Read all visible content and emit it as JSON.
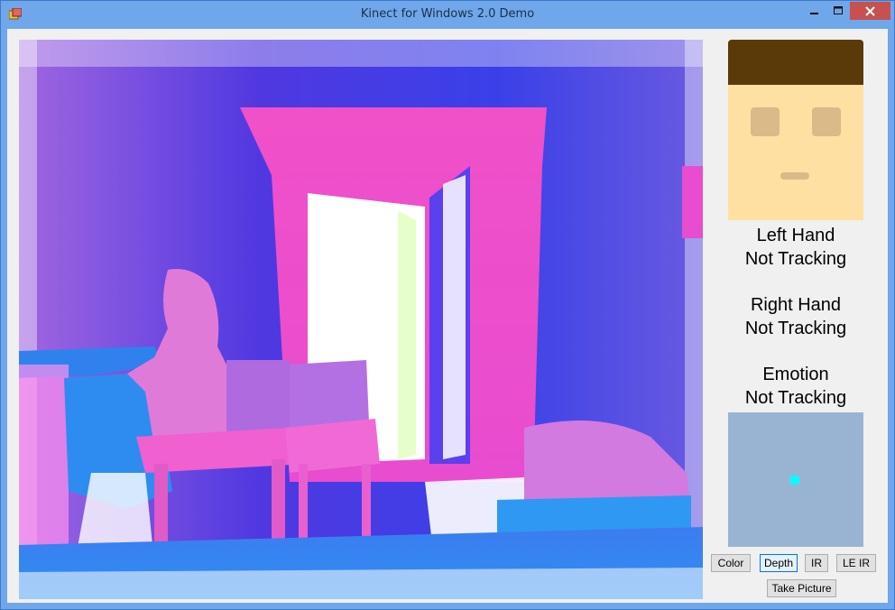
{
  "window": {
    "title": "Kinect for Windows 2.0 Demo",
    "icons": {
      "app": "app-icon",
      "minimize": "minimize-icon",
      "maximize": "maximize-icon",
      "close": "close-icon"
    }
  },
  "status": {
    "left_hand": {
      "label": "Left Hand",
      "value": "Not Tracking"
    },
    "right_hand": {
      "label": "Right Hand",
      "value": "Not Tracking"
    },
    "emotion": {
      "label": "Emotion",
      "value": "Not Tracking"
    }
  },
  "buttons": {
    "color": "Color",
    "depth": "Depth",
    "ir": "IR",
    "le_ir": "LE IR",
    "take_picture": "Take Picture"
  },
  "colors": {
    "hair": "#5a3a08",
    "skin": "#ffe0a3",
    "face_features": "#d9ba88",
    "tracking_bg": "#98b4d2",
    "tracking_dot": "#00ffff",
    "close_button": "#c75050"
  }
}
